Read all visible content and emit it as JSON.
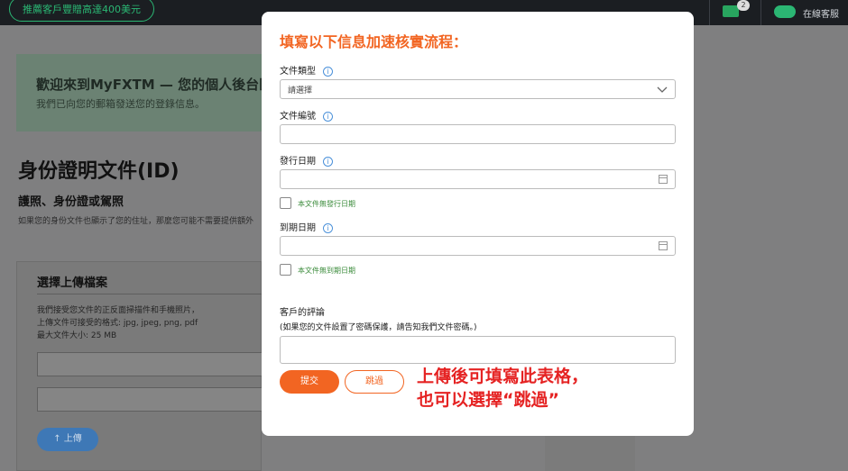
{
  "topbar": {
    "promo_label": "推薦客戶豐贈高達400美元",
    "mail_badge": "2",
    "chat_label": "在線客服"
  },
  "page": {
    "welcome_title": "歡迎來到MyFXTM — 您的個人後台區",
    "welcome_sub": "我們已向您的郵箱發送您的登錄信息。",
    "heading": "身份證明文件(ID)",
    "subheading": "護照、身份證或駕照",
    "note": "如果您的身份文件也顯示了您的住址，那麼您可能不需要提供額外",
    "upload": {
      "title": "選擇上傳檔案",
      "desc1": "我們接受您文件的正反面掃描件和手機照片，",
      "desc2": "上傳文件可接受的格式: jpg, jpeg, png, pdf",
      "desc3": "最大文件大小: 25 MB",
      "button": "↑ 上傳"
    }
  },
  "modal": {
    "title": "填寫以下信息加速核實流程：",
    "doc_type_label": "文件類型",
    "doc_type_value": "請選擇",
    "doc_number_label": "文件編號",
    "issue_date_label": "發行日期",
    "no_issue_date": "本文件無發行日期",
    "expiry_date_label": "到期日期",
    "no_expiry_date": "本文件無到期日期",
    "comment_label": "客戶的評論",
    "comment_hint": "(如果您的文件設置了密碼保護，請告知我們文件密碼。)",
    "submit": "提交",
    "skip": "跳過",
    "annotation_line1": "上傳後可填寫此表格，",
    "annotation_line2": "也可以選擇“跳過”"
  }
}
